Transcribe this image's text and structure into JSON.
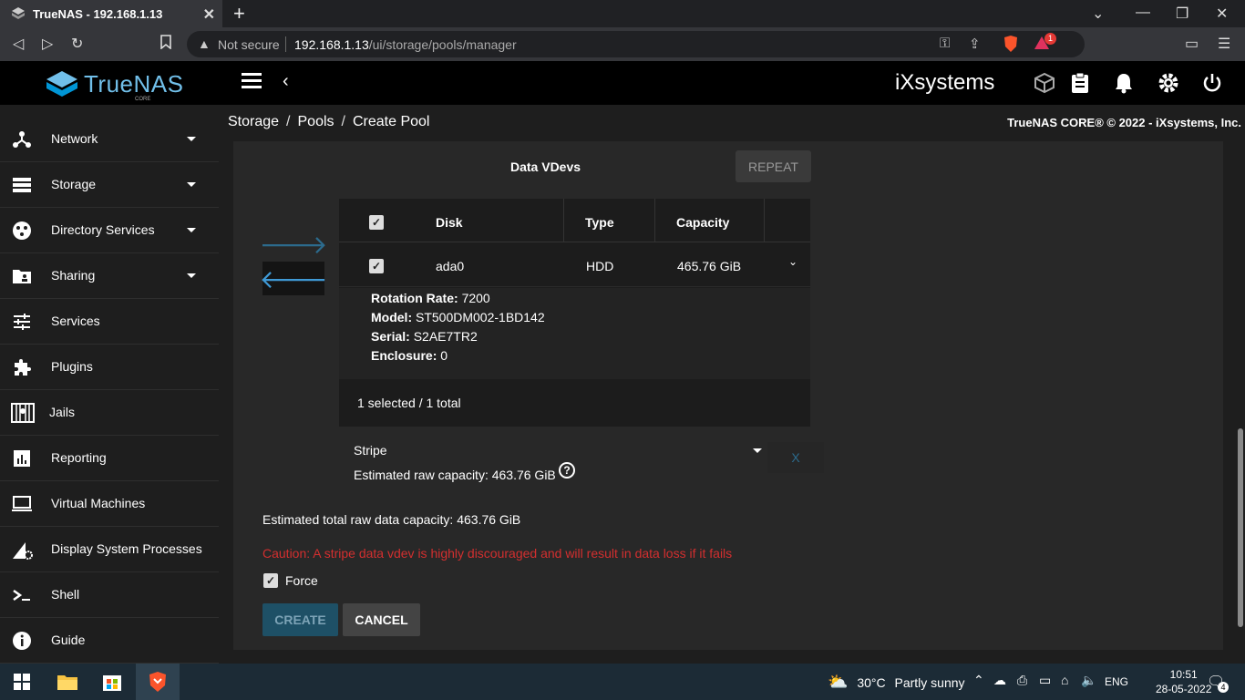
{
  "browser": {
    "tab_title": "TrueNAS - 192.168.1.13",
    "security_label": "Not secure",
    "url_host": "192.168.1.13",
    "url_path": "/ui/storage/pools/manager",
    "notification_count": "1"
  },
  "header": {
    "brand": "TrueNAS",
    "brand_sub": "CORE",
    "partner_logo": "iXsystems"
  },
  "sidebar": {
    "items": [
      {
        "label": "Network",
        "icon": "network-icon"
      },
      {
        "label": "Storage",
        "icon": "storage-icon"
      },
      {
        "label": "Directory Services",
        "icon": "directory-services-icon"
      },
      {
        "label": "Sharing",
        "icon": "sharing-icon"
      },
      {
        "label": "Services",
        "icon": "services-icon"
      },
      {
        "label": "Plugins",
        "icon": "plugins-icon"
      },
      {
        "label": "Jails",
        "icon": "jails-icon"
      },
      {
        "label": "Reporting",
        "icon": "reporting-icon"
      },
      {
        "label": "Virtual Machines",
        "icon": "virtual-machines-icon"
      },
      {
        "label": "Display System Processes",
        "icon": "system-processes-icon"
      },
      {
        "label": "Shell",
        "icon": "shell-icon"
      },
      {
        "label": "Guide",
        "icon": "guide-icon"
      }
    ]
  },
  "breadcrumb": {
    "items": [
      "Storage",
      "Pools",
      "Create Pool"
    ],
    "copyright": "TrueNAS CORE® © 2022 - iXsystems, Inc."
  },
  "vdev": {
    "title": "Data VDevs",
    "repeat_label": "REPEAT",
    "table": {
      "headers": [
        "Disk",
        "Type",
        "Capacity"
      ],
      "row": {
        "disk": "ada0",
        "type": "HDD",
        "capacity": "465.76 GiB"
      },
      "details": [
        {
          "key": "Rotation Rate:",
          "value": "7200"
        },
        {
          "key": "Model:",
          "value": "ST500DM002-1BD142"
        },
        {
          "key": "Serial:",
          "value": "S2AE7TR2"
        },
        {
          "key": "Enclosure:",
          "value": "0"
        }
      ],
      "footer": "1 selected / 1 total"
    },
    "layout_type": "Stripe",
    "remove_label": "X",
    "estimated_raw": "Estimated raw capacity: 463.76 GiB"
  },
  "form": {
    "estimated_total": "Estimated total raw data capacity: 463.76 GiB",
    "caution": "Caution: A stripe data vdev is highly discouraged and will result in data loss if it fails",
    "force_label": "Force",
    "create_label": "CREATE",
    "cancel_label": "CANCEL"
  },
  "taskbar": {
    "temperature": "30°C",
    "weather": "Partly sunny",
    "language": "ENG",
    "time": "10:51",
    "date": "28-05-2022",
    "notifications": "4"
  },
  "colors": {
    "brand": "#71bfe9",
    "accent": "#3f99d5",
    "warning": "#d32f2f"
  }
}
